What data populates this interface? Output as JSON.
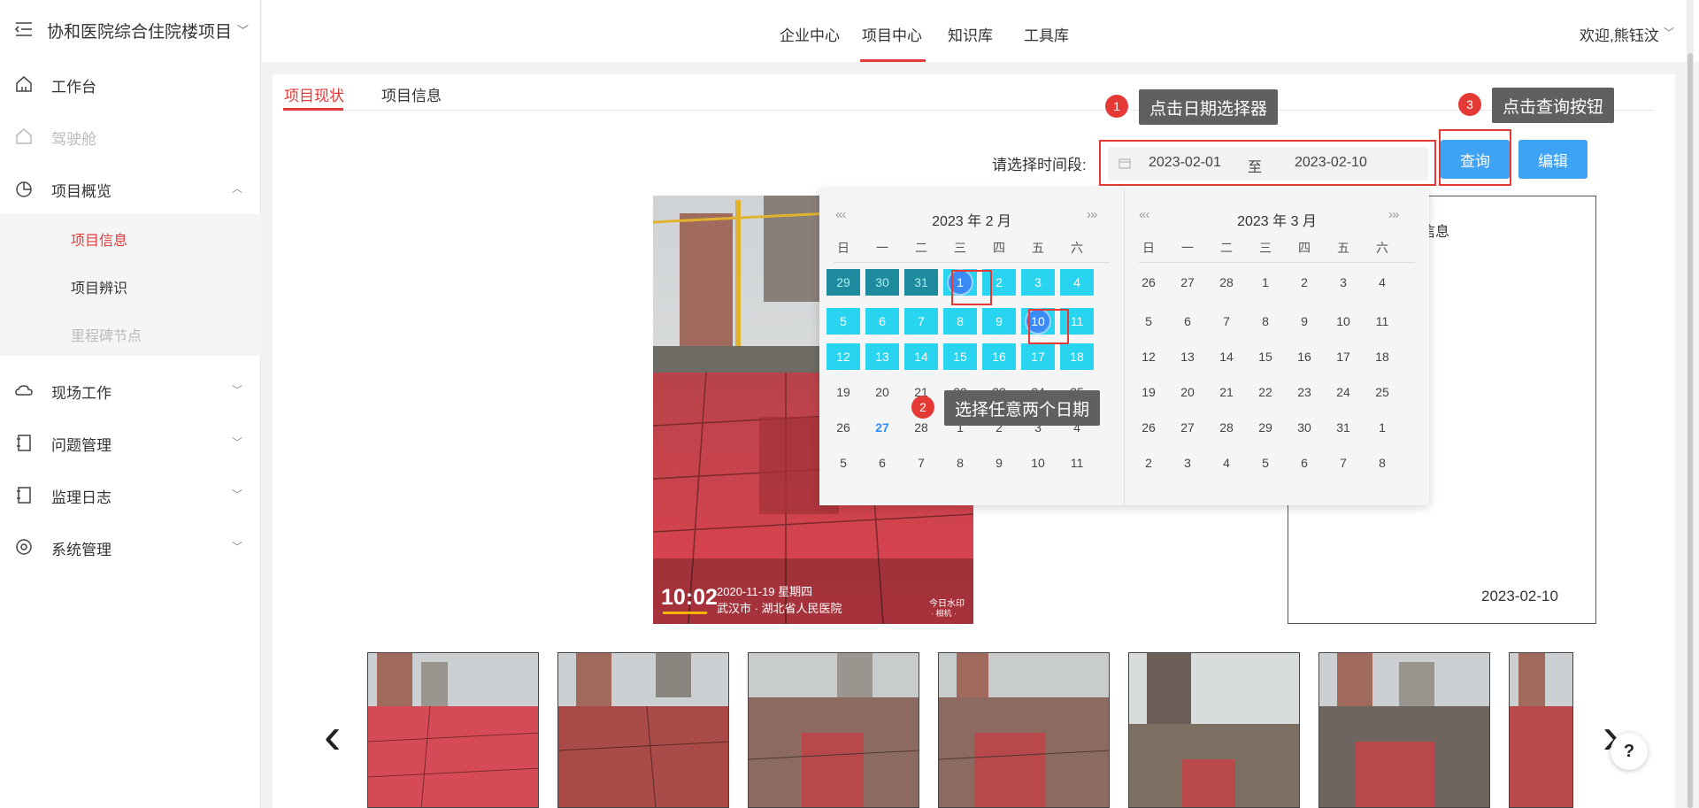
{
  "sidebar": {
    "project_title": "协和医院综合住院楼项目",
    "items": [
      {
        "label": "工作台"
      },
      {
        "label": "驾驶舱"
      },
      {
        "label": "项目概览"
      },
      {
        "label": "现场工作"
      },
      {
        "label": "问题管理"
      },
      {
        "label": "监理日志"
      },
      {
        "label": "系统管理"
      }
    ],
    "sub_items": [
      {
        "label": "项目信息"
      },
      {
        "label": "项目辨识"
      },
      {
        "label": "里程碑节点"
      }
    ]
  },
  "topbar": {
    "tabs": [
      {
        "label": "企业中心"
      },
      {
        "label": "项目中心"
      },
      {
        "label": "知识库"
      },
      {
        "label": "工具库"
      }
    ],
    "welcome": "欢迎,熊钰汶"
  },
  "content": {
    "sub_tabs": [
      {
        "label": "项目现状"
      },
      {
        "label": "项目信息"
      }
    ],
    "date_label": "请选择时间段:",
    "date_start": "2023-02-01",
    "date_sep": "至",
    "date_end": "2023-02-10",
    "query_button": "查询",
    "edit_button": "编辑",
    "info_title": "信息",
    "info_date": "2023-02-10"
  },
  "callouts": [
    {
      "badge": "1",
      "text": "点击日期选择器"
    },
    {
      "badge": "2",
      "text": "选择任意两个日期"
    },
    {
      "badge": "3",
      "text": "点击查询按钮"
    }
  ],
  "photo_overlay": {
    "time": "10:02",
    "date_line": "2020-11-19 星期四",
    "location": "武汉市 · 湖北省人民医院",
    "watermark_1": "今日水印",
    "watermark_2": "· 相机 ·"
  },
  "calendar": {
    "left_title": "2023 年 2 月",
    "right_title": "2023 年 3 月",
    "weekdays": [
      "日",
      "一",
      "二",
      "三",
      "四",
      "五",
      "六"
    ],
    "nav_prev": "«‹",
    "nav_next": "›»",
    "left_rows": [
      [
        "29",
        "30",
        "31",
        "1",
        "2",
        "3",
        "4"
      ],
      [
        "5",
        "6",
        "7",
        "8",
        "9",
        "10",
        "11"
      ],
      [
        "12",
        "13",
        "14",
        "15",
        "16",
        "17",
        "18"
      ],
      [
        "19",
        "20",
        "21",
        "22",
        "23",
        "24",
        "25"
      ],
      [
        "26",
        "27",
        "28",
        "1",
        "2",
        "3",
        "4"
      ],
      [
        "5",
        "6",
        "7",
        "8",
        "9",
        "10",
        "11"
      ]
    ],
    "right_rows": [
      [
        "26",
        "27",
        "28",
        "1",
        "2",
        "3",
        "4"
      ],
      [
        "5",
        "6",
        "7",
        "8",
        "9",
        "10",
        "11"
      ],
      [
        "12",
        "13",
        "14",
        "15",
        "16",
        "17",
        "18"
      ],
      [
        "19",
        "20",
        "21",
        "22",
        "23",
        "24",
        "25"
      ],
      [
        "26",
        "27",
        "28",
        "29",
        "30",
        "31",
        "1"
      ],
      [
        "2",
        "3",
        "4",
        "5",
        "6",
        "7",
        "8"
      ]
    ]
  },
  "help_label": "?",
  "colors": {
    "accent_red": "#e23b3b",
    "button_blue": "#3fa3f5",
    "range_cyan": "#29d4f0",
    "selected_blue": "#3a8bf5"
  }
}
